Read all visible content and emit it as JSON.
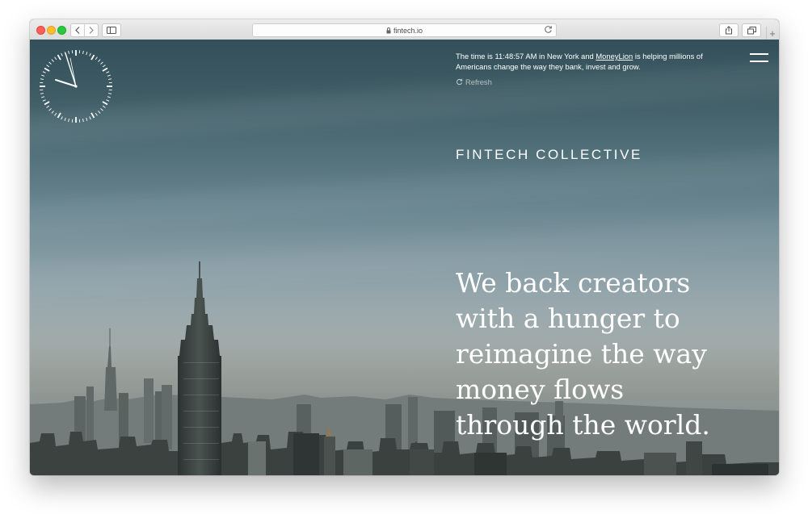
{
  "browser": {
    "url": "fintech.io",
    "colors": {
      "close": "#fe5f57",
      "minimize": "#febc2e",
      "zoom": "#28c840"
    },
    "icons": [
      "back-icon",
      "forward-icon",
      "sidebar-icon",
      "lock-icon",
      "reload-icon",
      "share-icon",
      "tabs-icon",
      "plus-icon"
    ],
    "new_tab_glyph": "+"
  },
  "hero": {
    "clock_time": "11:48:57",
    "info": {
      "prefix": "The time is 11:48:57  AM in New York and",
      "company_link": "MoneyLion",
      "suffix": "is helping millions of Americans change the way they bank, invest and grow."
    },
    "refresh_label": "Refresh",
    "brand": "FINTECH COLLECTIVE",
    "headline_lines": [
      "We back creators",
      "with a hunger to",
      "reimagine the way",
      "money flows",
      "through the world."
    ]
  }
}
